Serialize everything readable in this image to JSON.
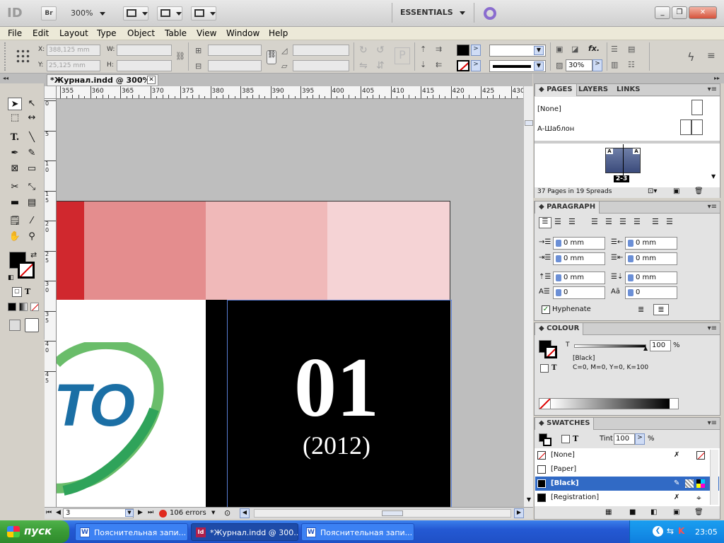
{
  "titlebar": {
    "app_logo": "ID",
    "bridge_label": "Br",
    "zoom_value": "300%",
    "workspace": "ESSENTIALS"
  },
  "menu": [
    "File",
    "Edit",
    "Layout",
    "Type",
    "Object",
    "Table",
    "View",
    "Window",
    "Help"
  ],
  "controlbar": {
    "x_label": "X:",
    "x_value": "388,125 mm",
    "y_label": "Y:",
    "y_value": "25,125 mm",
    "w_label": "W:",
    "h_label": "H:",
    "stroke_percent": "30%"
  },
  "document_tab": "*Журнал.indd @ 300%",
  "ruler_top": [
    "355",
    "360",
    "365",
    "370",
    "375",
    "380",
    "385",
    "390",
    "395",
    "400",
    "405",
    "410",
    "415",
    "420",
    "425",
    "430"
  ],
  "ruler_left": [
    "0",
    "5",
    "1 0",
    "1 5",
    "2 0",
    "2 5",
    "3 0",
    "3 5",
    "4 0",
    "4 5"
  ],
  "artwork": {
    "big_number": "01",
    "year": "(2012)",
    "logo_letters": "TO",
    "color_strip": [
      "#d0282e",
      "#e48d8e",
      "#f0b9b9",
      "#f5d3d5"
    ]
  },
  "statusbar": {
    "page": "3",
    "errors": "106 errors"
  },
  "pages_panel": {
    "tabs": [
      "PAGES",
      "LAYERS",
      "LINKS"
    ],
    "none_master": "[None]",
    "a_master": "A-Шаблон",
    "spread_label": "2-3",
    "page_marker": "A",
    "summary": "37 Pages in 19 Spreads"
  },
  "paragraph_panel": {
    "title": "PARAGRAPH",
    "left_indent": "0 mm",
    "right_indent": "0 mm",
    "first_line_indent": "0 mm",
    "last_line_indent": "0 mm",
    "space_before": "0 mm",
    "space_after": "0 mm",
    "drop_cap_lines": "0",
    "drop_cap_chars": "0",
    "hyphenate_label": "Hyphenate",
    "hyphenate_checked": true
  },
  "colour_panel": {
    "title": "COLOUR",
    "t_label": "T",
    "tint_value": "100",
    "percent": "%",
    "swatch_name": "[Black]",
    "cmyk": "C=0, M=0, Y=0, K=100"
  },
  "swatches_panel": {
    "title": "SWATCHES",
    "tint_label": "Tint:",
    "tint_value": "100",
    "percent": "%",
    "items": [
      {
        "name": "[None]",
        "color": "none"
      },
      {
        "name": "[Paper]",
        "color": "#ffffff"
      },
      {
        "name": "[Black]",
        "color": "#000000"
      },
      {
        "name": "[Registration]",
        "color": "#000000"
      }
    ],
    "selected": "[Black]"
  },
  "taskbar": {
    "start": "пуск",
    "tasks": [
      "Пояснительная запи...",
      "*Журнал.indd @ 300...",
      "Пояснительная запи..."
    ],
    "language": "RU",
    "clock": "23:05"
  },
  "colors": {
    "accent_blue": "#316ac5",
    "taskbar_blue": "#245edb",
    "start_green": "#3a9b36"
  }
}
